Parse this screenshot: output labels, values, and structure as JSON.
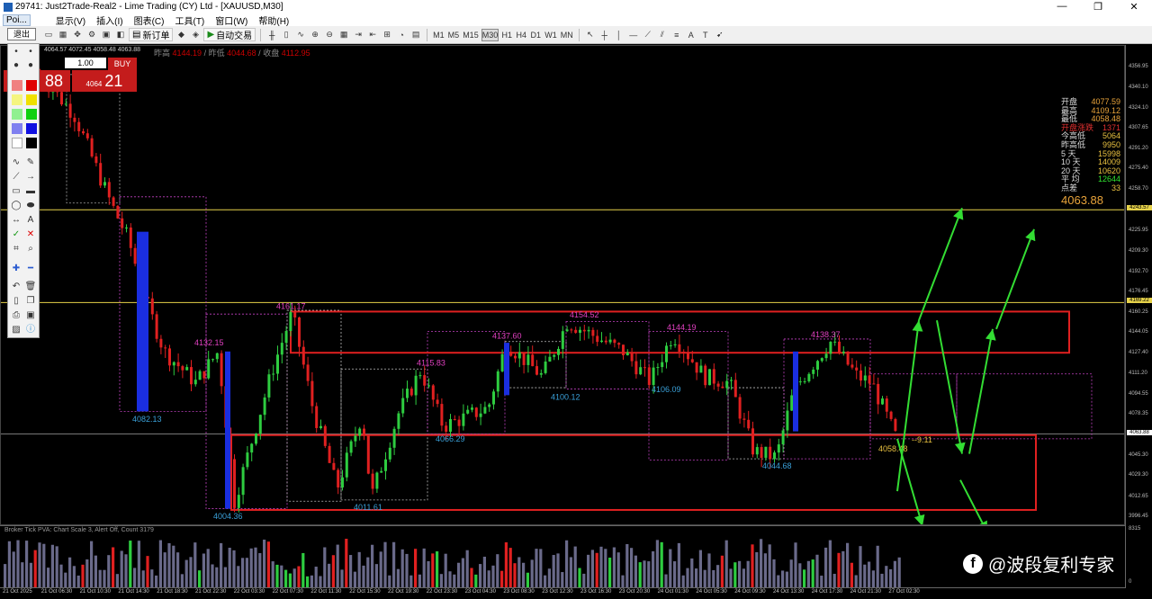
{
  "window": {
    "title": "29741: Just2Trade-Real2 - Lime Trading (CY) Ltd - [XAUUSD,M30]",
    "controls": [
      "—",
      "❐",
      "✕"
    ]
  },
  "menu": {
    "poi": "Poi...",
    "items": [
      "显示(V)",
      "插入(I)",
      "图表(C)",
      "工具(T)",
      "窗口(W)",
      "帮助(H)"
    ]
  },
  "toolbar": {
    "new_order": "新订单",
    "auto_trade": "自动交易",
    "timeframes": [
      "M1",
      "M5",
      "M15",
      "M30",
      "H1",
      "H4",
      "D1",
      "W1",
      "MN"
    ],
    "active_timeframe": "M30"
  },
  "exit_label": "退出",
  "trade": {
    "lot": "1.00",
    "buy": "BUY",
    "bid_big": "88",
    "ask_small": "4064",
    "ask_big": "21"
  },
  "chart_header": {
    "ohlc": "4064.57 4072.45 4058.48 4063.88",
    "prev_high_label": "昨高",
    "prev_high": "4144.19",
    "prev_low_label": "昨低",
    "prev_low": "4044.68",
    "prev_close_label": "收盘",
    "prev_close": "4112.95"
  },
  "info": {
    "rows": [
      {
        "label": "开盘",
        "value": "4077.59",
        "color": "#e8a33a"
      },
      {
        "label": "最高",
        "value": "4109.12",
        "color": "#e8a33a"
      },
      {
        "label": "最低",
        "value": "4058.48",
        "color": "#e8a33a"
      },
      {
        "label": "开盘涨跌",
        "value": "1371",
        "color": "#e23030"
      },
      {
        "label": "今高低",
        "value": "5064",
        "color": "#e8c040"
      },
      {
        "label": "昨高低",
        "value": "9950",
        "color": "#e8c040"
      },
      {
        "label": "5   天",
        "value": "15998",
        "color": "#e8c040"
      },
      {
        "label": "10  天",
        "value": "14009",
        "color": "#e8c040"
      },
      {
        "label": "20  天",
        "value": "10620",
        "color": "#e8c040"
      },
      {
        "label": "平   均",
        "value": "12644",
        "color": "#30e030"
      },
      {
        "label": "点差",
        "value": "33",
        "color": "#e8c040"
      }
    ],
    "price": "4063.88"
  },
  "chart_data": {
    "type": "candlestick",
    "symbol": "XAUUSD",
    "timeframe": "M30",
    "ylim": [
      3990,
      4375
    ],
    "yticks": [
      "4356.95",
      "4340.10",
      "4324.10",
      "4307.65",
      "4291.20",
      "4275.40",
      "4258.70",
      "4243.57",
      "4225.95",
      "4209.30",
      "4192.70",
      "4176.45",
      "4169.22",
      "4160.25",
      "4144.05",
      "4127.40",
      "4111.20",
      "4094.55",
      "4078.35",
      "4063.88",
      "4045.30",
      "4029.30",
      "4012.65",
      "3996.45"
    ],
    "hlines": [
      {
        "value": 4243.57,
        "color": "#e6d24a"
      },
      {
        "value": 4169.22,
        "color": "#e6d24a"
      },
      {
        "value": 4063.88,
        "color": "#777777"
      }
    ],
    "annotations": [
      {
        "text": "4161.17",
        "price": 4161.17,
        "color": "#e040c0"
      },
      {
        "text": "4132.15",
        "price": 4132.15,
        "color": "#e040c0"
      },
      {
        "text": "4082.13",
        "price": 4082.13,
        "color": "#3aa0d8"
      },
      {
        "text": "4004.36",
        "price": 4004.36,
        "color": "#3aa0d8"
      },
      {
        "text": "4011.61",
        "price": 4011.61,
        "color": "#3aa0d8"
      },
      {
        "text": "4115.83",
        "price": 4115.83,
        "color": "#e040c0"
      },
      {
        "text": "4066.29",
        "price": 4066.29,
        "color": "#3aa0d8"
      },
      {
        "text": "4137.60",
        "price": 4137.6,
        "color": "#e040c0"
      },
      {
        "text": "4154.52",
        "price": 4154.52,
        "color": "#e040c0"
      },
      {
        "text": "4100.12",
        "price": 4100.12,
        "color": "#3aa0d8"
      },
      {
        "text": "4144.19",
        "price": 4144.19,
        "color": "#e040c0"
      },
      {
        "text": "4106.09",
        "price": 4106.09,
        "color": "#3aa0d8"
      },
      {
        "text": "4044.68",
        "price": 4044.68,
        "color": "#3aa0d8"
      },
      {
        "text": "4138.37",
        "price": 4138.37,
        "color": "#e040c0"
      },
      {
        "text": "4058.48",
        "price": 4058.48,
        "color": "#e8c040"
      },
      {
        "text": "--9.11",
        "price": 4061.5,
        "color": "#e8c040"
      }
    ],
    "zones": [
      {
        "from": 4129,
        "to": 4162,
        "color": "#e02020"
      },
      {
        "from": 4003,
        "to": 4063,
        "color": "#e02020"
      }
    ]
  },
  "subwindow": {
    "label": "Broker Tick PVA:  Chart Scale  3,  Alert Off,  Count  3179",
    "max": "8315",
    "zero": "0"
  },
  "xaxis": [
    "21 Oct 2025",
    "21 Oct 06:30",
    "21 Oct 10:30",
    "21 Oct 14:30",
    "21 Oct 18:30",
    "21 Oct 22:30",
    "22 Oct 03:30",
    "22 Oct 07:30",
    "22 Oct 11:30",
    "22 Oct 15:30",
    "22 Oct 19:30",
    "22 Oct 23:30",
    "23 Oct 04:30",
    "23 Oct 08:30",
    "23 Oct 12:30",
    "23 Oct 16:30",
    "23 Oct 20:30",
    "24 Oct 01:30",
    "24 Oct 05:30",
    "24 Oct 09:30",
    "24 Oct 13:30",
    "24 Oct 17:30",
    "24 Oct 21:30",
    "27 Oct 02:30"
  ],
  "watermark": "@波段复利专家",
  "colors": {
    "bull": "#2ecc40",
    "bear": "#e02020",
    "arrow": "#33dd33",
    "box": "#c040c0"
  }
}
